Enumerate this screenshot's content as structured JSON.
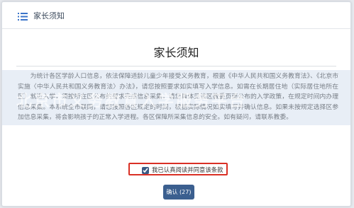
{
  "header": {
    "title": "家长须知",
    "icon": "list-icon"
  },
  "document": {
    "title": "家长须知",
    "paragraph": "为统计各区学龄人口信息，依法保障适龄儿童少年接受义务教育，根据《中华人民共和国义务教育法》、《北京市实施〈中华人民共和国义务教育法〉办法》，请您按照要求如实填写入学信息。如需在长期居住地（实际居住地所在区）就近入学，须按所在区公布的要求完成信息采集，请您具体见该区教委页面公布的入学政策，在规定时间内办理信息采集。本系统全市联网，请您按照各区规定的时间，根据实际情况如实填写并确认信息。如果未按规定选择区参加信息采集，将会影响孩子的正常入学进程。各区保障所采集信息的安全。如有疑问，请联系教委。",
    "watermark": "北京市义务教育入学服务平台"
  },
  "agreement": {
    "label": "我已认真阅读并同意该条款",
    "checked": true
  },
  "confirm": {
    "label": "确认 (27)"
  },
  "colors": {
    "accent": "#3b5f8f",
    "highlight_border": "#d93025"
  }
}
